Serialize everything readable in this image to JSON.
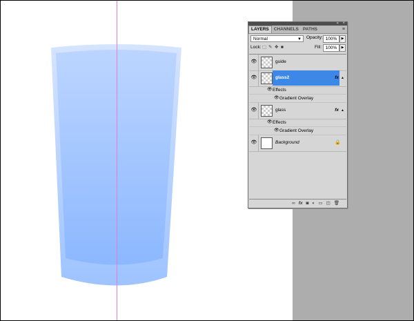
{
  "panel": {
    "tabs": [
      "LAYERS",
      "CHANNELS",
      "PATHS"
    ],
    "active_tab": "LAYERS",
    "blend_mode": "Normal",
    "opacity_label": "Opacity:",
    "opacity_value": "100%",
    "lock_label": "Lock:",
    "fill_label": "Fill:",
    "fill_value": "100%"
  },
  "layers": [
    {
      "name": "guide",
      "selected": false,
      "fx": "",
      "italic": false
    },
    {
      "name": "glass2",
      "selected": true,
      "fx": "fx",
      "italic": false
    },
    {
      "name": "glass",
      "selected": false,
      "fx": "fx",
      "italic": false
    },
    {
      "name": "Background",
      "selected": false,
      "fx": "",
      "italic": true
    }
  ],
  "effects": {
    "label": "Effects",
    "gradient_overlay": "Gradient Overlay"
  },
  "colors": {
    "canvas": "#ffffff",
    "pasteboard": "#adadad",
    "glass_light": "#cfe0ff",
    "glass_mid": "#a9c9ff",
    "glass_dark": "#7fb0fb",
    "guide": "#e87ad6",
    "selection": "#3d88e6"
  },
  "icons": {
    "eye": "eye-icon",
    "fx": "fx-icon",
    "lock": "lock-icon",
    "link": "link-icon",
    "mask": "mask-icon",
    "adjustment": "adjustment-icon",
    "folder": "folder-icon",
    "new_layer": "new-layer-icon",
    "trash": "trash-icon"
  }
}
